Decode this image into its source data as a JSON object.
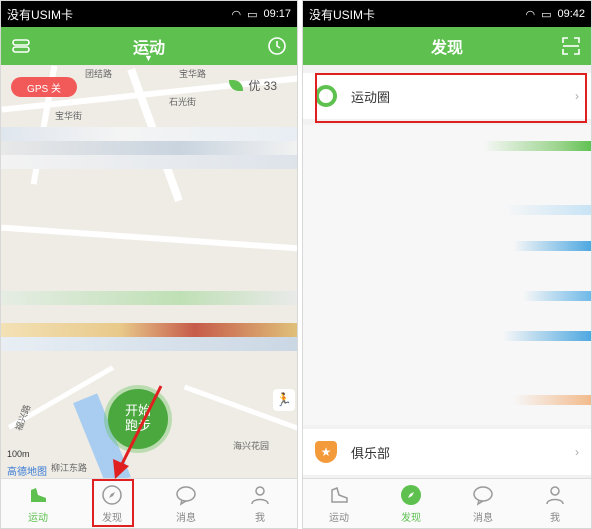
{
  "left_screen": {
    "status": {
      "carrier": "没有USIM卡",
      "time": "09:17"
    },
    "header": {
      "title": "运动"
    },
    "map": {
      "gps_label": "GPS  关",
      "aqi": "优 33",
      "start_button": "开始\n跑步",
      "scale": "100m",
      "provider": "高德地图",
      "place_labels": [
        "团结路",
        "宝华路",
        "石光街",
        "福兴路",
        "柳江东路",
        "海兴花园",
        "宝华街"
      ]
    },
    "tabs": [
      {
        "label": "运动",
        "icon": "shoe-icon"
      },
      {
        "label": "发现",
        "icon": "compass-icon"
      },
      {
        "label": "消息",
        "icon": "chat-bubble-icon"
      },
      {
        "label": "我",
        "icon": "person-icon"
      }
    ]
  },
  "right_screen": {
    "status": {
      "carrier": "没有USIM卡",
      "time": "09:42"
    },
    "header": {
      "title": "发现"
    },
    "items": [
      {
        "label": "运动圈",
        "icon": "ring-icon"
      },
      {
        "label": "俱乐部",
        "icon": "shield-star-icon"
      }
    ],
    "tabs": [
      {
        "label": "运动",
        "icon": "shoe-icon"
      },
      {
        "label": "发现",
        "icon": "compass-icon"
      },
      {
        "label": "消息",
        "icon": "chat-bubble-icon"
      },
      {
        "label": "我",
        "icon": "person-icon"
      }
    ]
  },
  "colors": {
    "brand": "#5dc04f",
    "highlight": "#e02020",
    "gps_off": "#f25a5a"
  }
}
